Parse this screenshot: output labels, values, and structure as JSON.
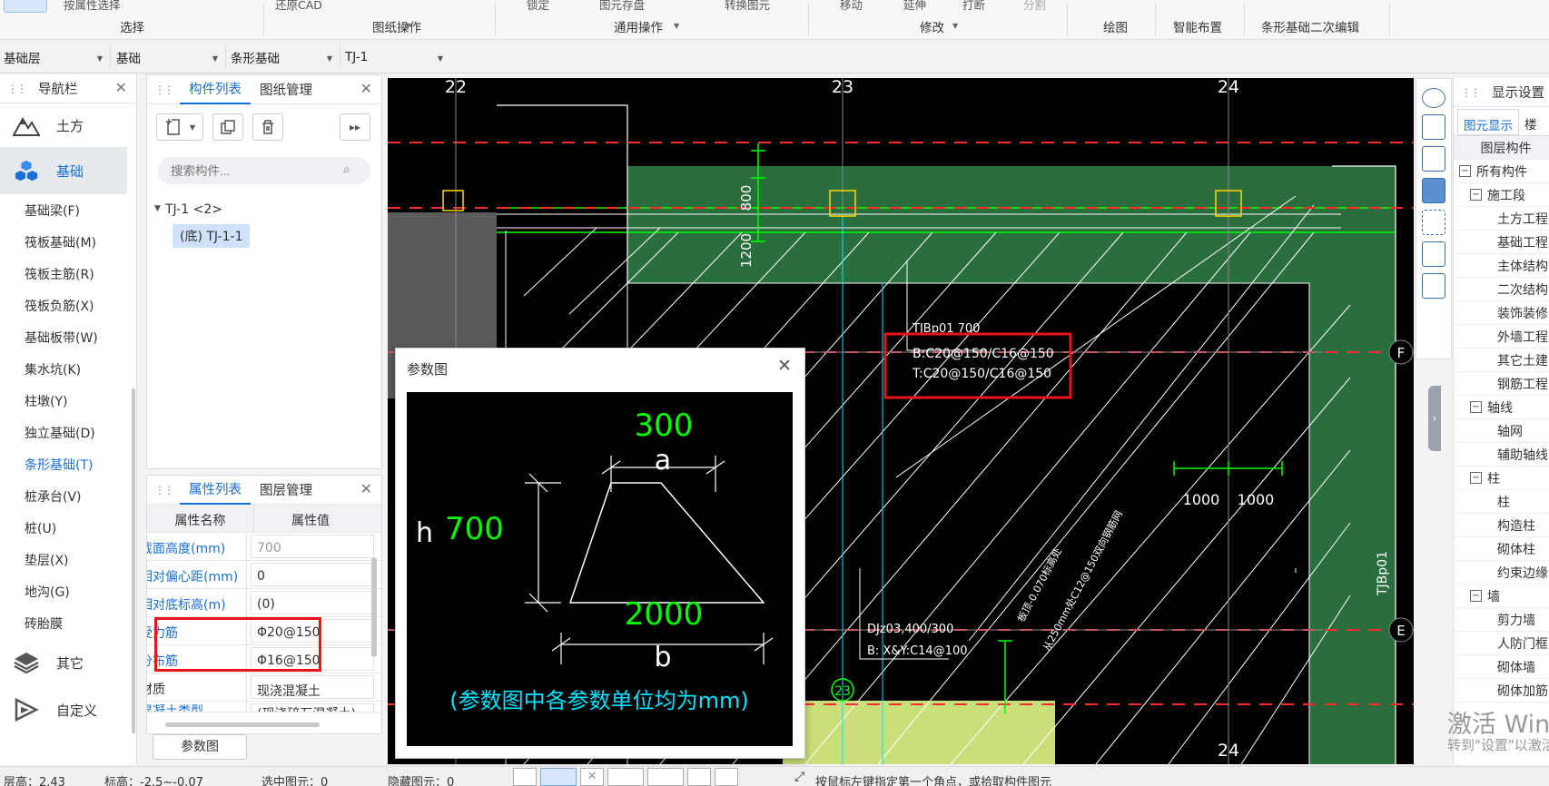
{
  "ribbon": {
    "top_items": [
      "按属性选择",
      "还原CAD",
      "锁定",
      "图元存盘",
      "转换图元",
      "移动",
      "延伸",
      "打断",
      "分割"
    ],
    "groups": {
      "select": "选择",
      "drawing_ops": "图纸操作",
      "common_ops": "通用操作",
      "modify": "修改",
      "draw": "绘图",
      "smart_layout": "智能布置",
      "strip_edit": "条形基础二次编辑"
    }
  },
  "selectors": {
    "floor": "基础层",
    "type": "基础",
    "subtype": "条形基础",
    "component": "TJ-1"
  },
  "nav": {
    "title": "导航栏",
    "cat_earth": "土方",
    "cat_foundation": "基础",
    "items": [
      "基础梁(F)",
      "筏板基础(M)",
      "筏板主筋(R)",
      "筏板负筋(X)",
      "基础板带(W)",
      "集水坑(K)",
      "柱墩(Y)",
      "独立基础(D)",
      "条形基础(T)",
      "桩承台(V)",
      "桩(U)",
      "垫层(X)",
      "地沟(G)",
      "砖胎膜"
    ],
    "cat_other": "其它",
    "cat_custom": "自定义"
  },
  "component_panel": {
    "tab_list": "构件列表",
    "tab_drawing": "图纸管理",
    "search_placeholder": "搜索构件...",
    "tree_parent": "TJ-1 <2>",
    "tree_child": "(底) TJ-1-1"
  },
  "property_panel": {
    "tab_props": "属性列表",
    "tab_layers": "图层管理",
    "col_name": "属性名称",
    "col_value": "属性值",
    "rows": [
      {
        "name": "截面高度(mm)",
        "value": "700"
      },
      {
        "name": "相对偏心距(mm)",
        "value": "0"
      },
      {
        "name": "相对底标高(m)",
        "value": "(0)"
      },
      {
        "name": "受力筋",
        "value": "Φ20@150"
      },
      {
        "name": "分布筋",
        "value": "Φ16@150"
      },
      {
        "name": "材质",
        "value": "现浇混凝土"
      },
      {
        "name": "混凝土类型",
        "value": "(现浇碎石混凝土)"
      }
    ],
    "param_button": "参数图"
  },
  "canvas": {
    "axes": [
      "22",
      "23",
      "24"
    ],
    "rows": [
      "F",
      "E"
    ],
    "dim_800": "800",
    "dim_1200": "1200",
    "label_tjbp": "TJBp01 700",
    "label_b": "B:C20@150/C16@150",
    "label_t": "T:C20@150/C16@150",
    "label_djz": "DJz03,400/300",
    "label_djz2": "B: X&Y:C14@100",
    "dim_1000a": "1000",
    "dim_1000b": "1000",
    "side_label": "TJBp01",
    "diag_text1": "板顶-0.070标高处",
    "diag_text2": "从250mm处C12@150双向钢筋网",
    "bottom_axis": "24",
    "bottom_circle": "23"
  },
  "dialog": {
    "title": "参数图",
    "top_value": "300",
    "top_symbol": "a",
    "h_symbol": "h",
    "h_value": "700",
    "bottom_value": "2000",
    "bottom_symbol": "b",
    "note": "(参数图中各参数单位均为mm)"
  },
  "display_settings": {
    "title": "显示设置",
    "tab1": "图元显示",
    "tab2": "楼",
    "header": "图层构件",
    "tree": [
      "所有构件",
      "施工段",
      "土方工程",
      "基础工程",
      "主体结构",
      "二次结构",
      "装饰装修",
      "外墙工程",
      "其它土建",
      "钢筋工程",
      "轴线",
      "轴网",
      "辅助轴线",
      "柱",
      "柱",
      "构造柱",
      "砌体柱",
      "约束边缘",
      "墙",
      "剪力墙",
      "人防门框",
      "砌体墙",
      "砌体加筋"
    ]
  },
  "watermark": {
    "line1": "激活 Windows",
    "line2": "转到\"设置\"以激活"
  },
  "status": {
    "floor_height": "层高：2.43",
    "elevation": "标高：-2.5~-0.07",
    "selected": "选中图元：0",
    "hidden": "隐藏图元：0",
    "hint": "按鼠标左键指定第一个角点，或拾取构件图元"
  },
  "colors": {
    "accent": "#1a6fd4",
    "highlight": "#e8141a",
    "foundation_fill": "#2b6e3e",
    "cad_green": "#00ff00",
    "cad_cyan": "#00e5ff"
  }
}
